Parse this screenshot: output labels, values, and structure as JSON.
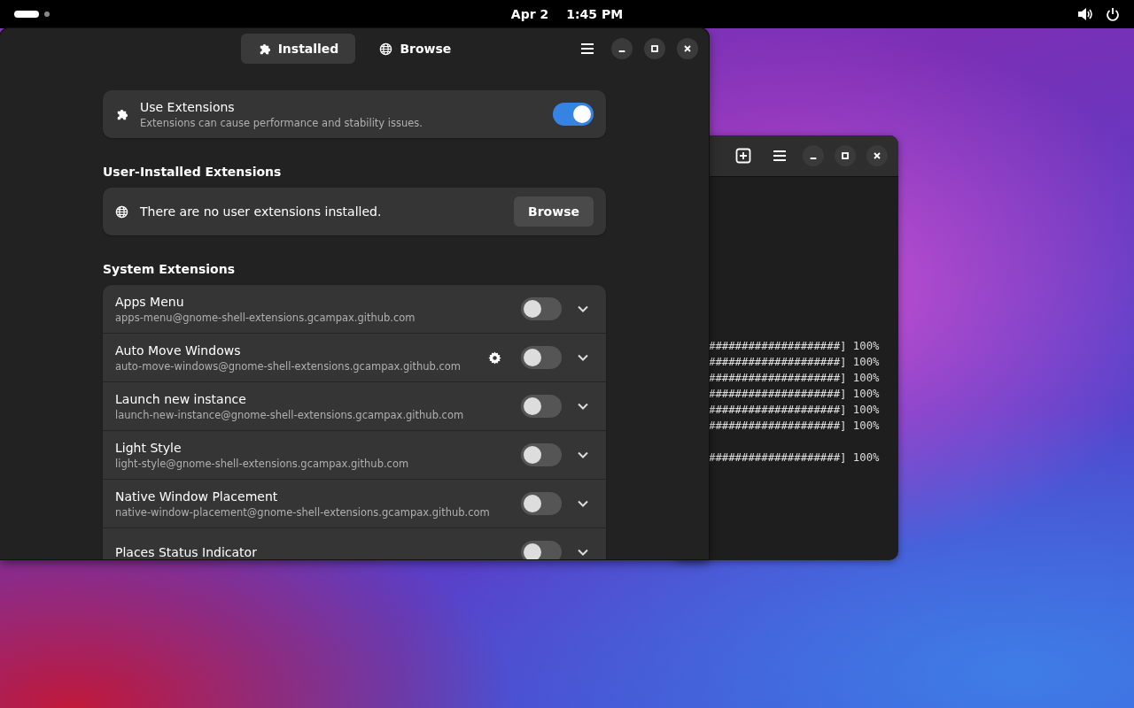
{
  "top_bar": {
    "date": "Apr 2",
    "time": "1:45 PM"
  },
  "terminal": {
    "output_blocks": [
      {
        "lines": [
          "####################] 100%",
          "####################] 100%",
          "####################] 100%",
          "####################] 100%",
          "####################] 100%",
          "####################] 100%"
        ]
      },
      {
        "lines": [
          "####################] 100%"
        ]
      }
    ]
  },
  "window": {
    "tabs": [
      {
        "label": "Installed",
        "selected": true
      },
      {
        "label": "Browse",
        "selected": false
      }
    ],
    "use_extensions": {
      "title": "Use Extensions",
      "subtitle": "Extensions can cause performance and stability issues.",
      "on": true
    },
    "user_section": {
      "heading": "User-Installed Extensions",
      "message": "There are no user extensions installed.",
      "button": "Browse"
    },
    "system_section": {
      "heading": "System Extensions",
      "extensions": [
        {
          "name": "Apps Menu",
          "id": "apps-menu@gnome-shell-extensions.gcampax.github.com",
          "on": false,
          "has_settings": false
        },
        {
          "name": "Auto Move Windows",
          "id": "auto-move-windows@gnome-shell-extensions.gcampax.github.com",
          "on": false,
          "has_settings": true
        },
        {
          "name": "Launch new instance",
          "id": "launch-new-instance@gnome-shell-extensions.gcampax.github.com",
          "on": false,
          "has_settings": false
        },
        {
          "name": "Light Style",
          "id": "light-style@gnome-shell-extensions.gcampax.github.com",
          "on": false,
          "has_settings": false
        },
        {
          "name": "Native Window Placement",
          "id": "native-window-placement@gnome-shell-extensions.gcampax.github.com",
          "on": false,
          "has_settings": false
        },
        {
          "name": "Places Status Indicator",
          "on": false,
          "has_settings": false
        }
      ]
    }
  }
}
